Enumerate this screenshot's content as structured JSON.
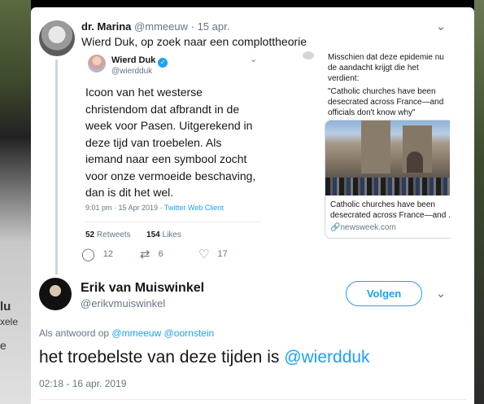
{
  "background": {
    "snippets": [
      "lu",
      "xele",
      "e"
    ]
  },
  "parent_tweet": {
    "name": "dr. Marina",
    "handle": "@mmeeuw",
    "separator": "·",
    "date": "15 apr.",
    "text": "Wierd Duk, op zoek naar een complottheorie",
    "actions": {
      "replies": "12",
      "retweets": "6",
      "likes": "17"
    }
  },
  "embedded_tweet": {
    "name": "Wierd Duk",
    "handle": "@wierdduk",
    "text": "Icoon van het westerse christendom dat afbrandt in de week voor Pasen. Uitgerekend in deze tijd van troebelen. Als iemand naar een symbool zocht voor onze vermoeide beschaving, dan is dit het wel.",
    "time": "9:01 pm · 15 Apr 2019 ·",
    "client": "Twitter Web Client",
    "retweets_count": "52",
    "retweets_label": "Retweets",
    "likes_count": "154",
    "likes_label": "Likes"
  },
  "embedded_second": {
    "intro": "Misschien dat deze epidemie nu de aandacht krijgt die het verdient:",
    "quote": "\"Catholic churches have been desecrated across France—and officials don't know why\"",
    "card_title": "Catholic churches have been desecrated across France—and ...",
    "card_source": "newsweek.com"
  },
  "reply_tweet": {
    "name": "Erik van Muiswinkel",
    "handle": "@erikvmuiswinkel",
    "follow_label": "Volgen",
    "reply_prefix": "Als antwoord op",
    "reply_mention_1": "@mmeeuw",
    "reply_mention_2": "@oornstein",
    "text_main": "het troebelste van deze tijden is",
    "text_mention": "@wierdduk",
    "timestamp": "02:18 - 16 apr. 2019"
  },
  "colors": {
    "accent": "#1da1f2",
    "muted": "#657786",
    "text": "#14171a"
  },
  "icons": {
    "verified": "verified-badge-icon",
    "reply": "reply-icon",
    "retweet": "retweet-icon",
    "like": "heart-icon",
    "more": "chevron-down-icon",
    "link": "link-icon"
  }
}
